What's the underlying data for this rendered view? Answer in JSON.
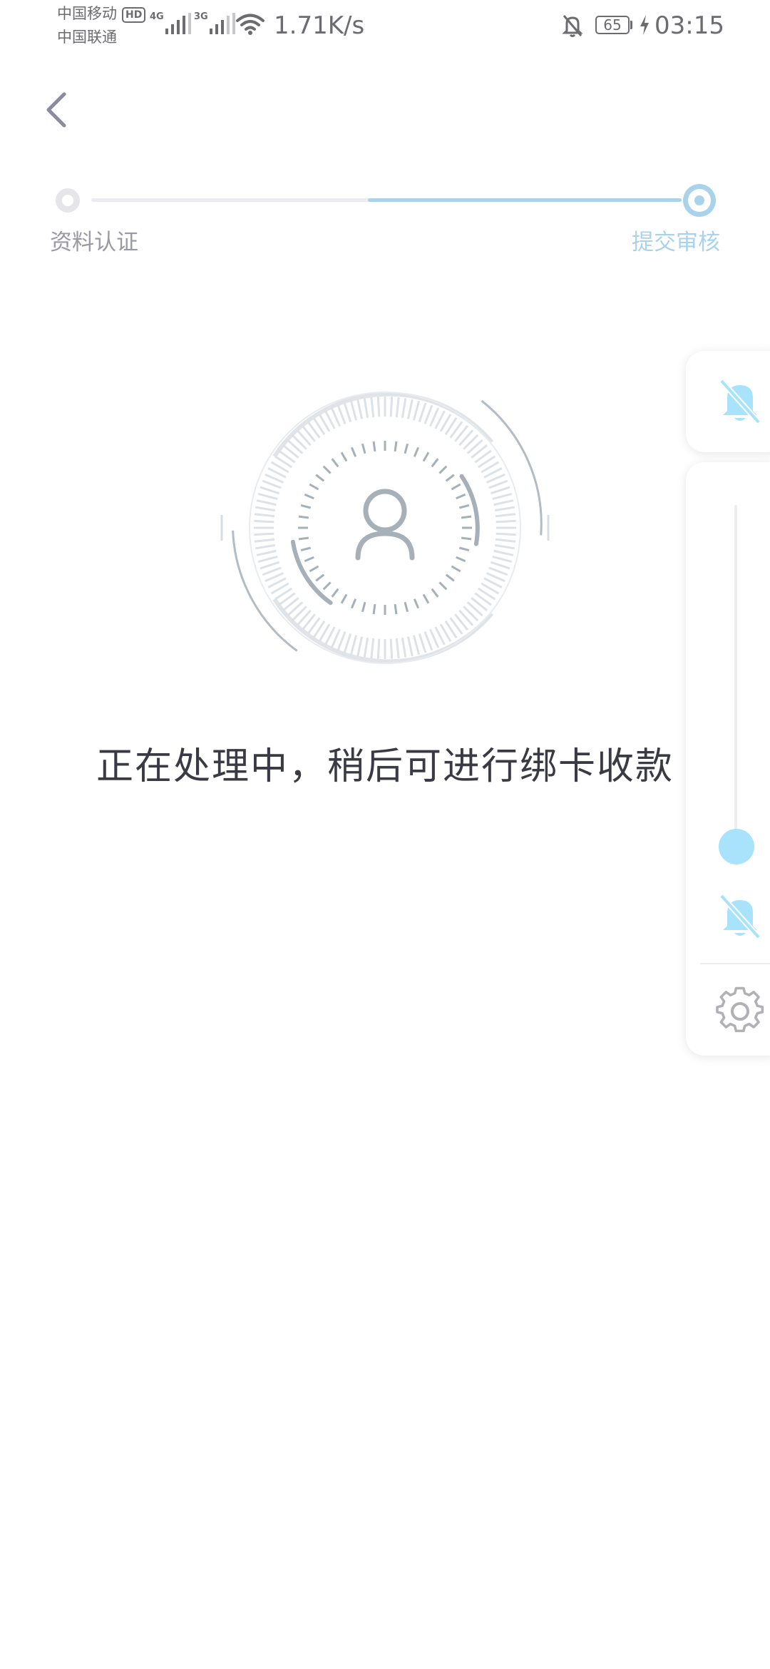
{
  "status_bar": {
    "carrier_1": "中国移动",
    "carrier_2": "中国联通",
    "hd_badge": "HD",
    "network_1": "4G",
    "network_2": "3G",
    "net_speed": "1.71K/s",
    "battery_level": "65",
    "time": "03:15"
  },
  "stepper": {
    "step_1_label": "资料认证",
    "step_2_label": "提交审核",
    "active_step": 2,
    "colors": {
      "active": "#a9d3ea",
      "inactive": "#e5e5ea"
    }
  },
  "main": {
    "message": "正在处理中，稍后可进行绑卡收款"
  },
  "volume_panel": {
    "volume_fraction": 0.05,
    "thumb_color": "#a8e2fb",
    "icons": [
      "bell-off-icon",
      "bell-off-icon",
      "gear-icon"
    ]
  },
  "icons": {
    "back": "chevron-left-icon",
    "illustration": "user-avatar-icon"
  }
}
